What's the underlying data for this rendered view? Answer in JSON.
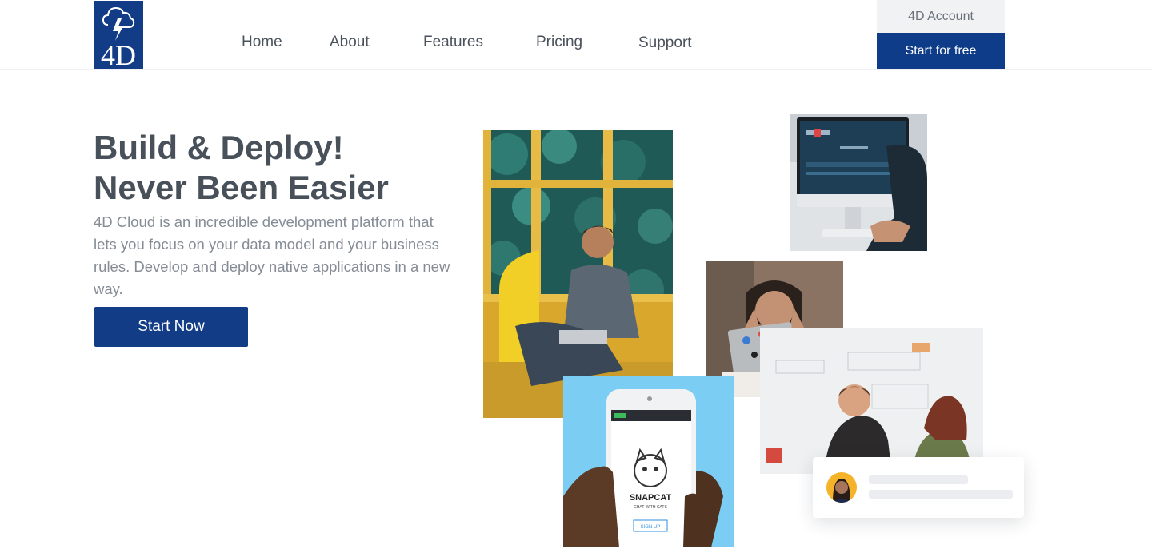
{
  "header": {
    "logo_text": "4D",
    "nav": [
      {
        "label": "Home"
      },
      {
        "label": "About"
      },
      {
        "label": "Features"
      },
      {
        "label": "Pricing"
      },
      {
        "label": "Support"
      }
    ],
    "account_label": "4D Account",
    "start_free_label": "Start for free"
  },
  "hero": {
    "title_line1": "Build & Deploy!",
    "title_line2": "Never Been Easier",
    "description": "4D Cloud is an incredible development platform that lets you focus on your data model and your business rules. Develop and deploy native applications in a new way.",
    "cta_label": "Start Now"
  },
  "collage": {
    "phone_app_name": "SNAPCAT",
    "phone_app_tagline": "CHAT WITH CATS",
    "phone_button": "SIGN UP"
  },
  "colors": {
    "brand_blue": "#123c86",
    "text_dark": "#48505a",
    "text_muted": "#858c96"
  }
}
